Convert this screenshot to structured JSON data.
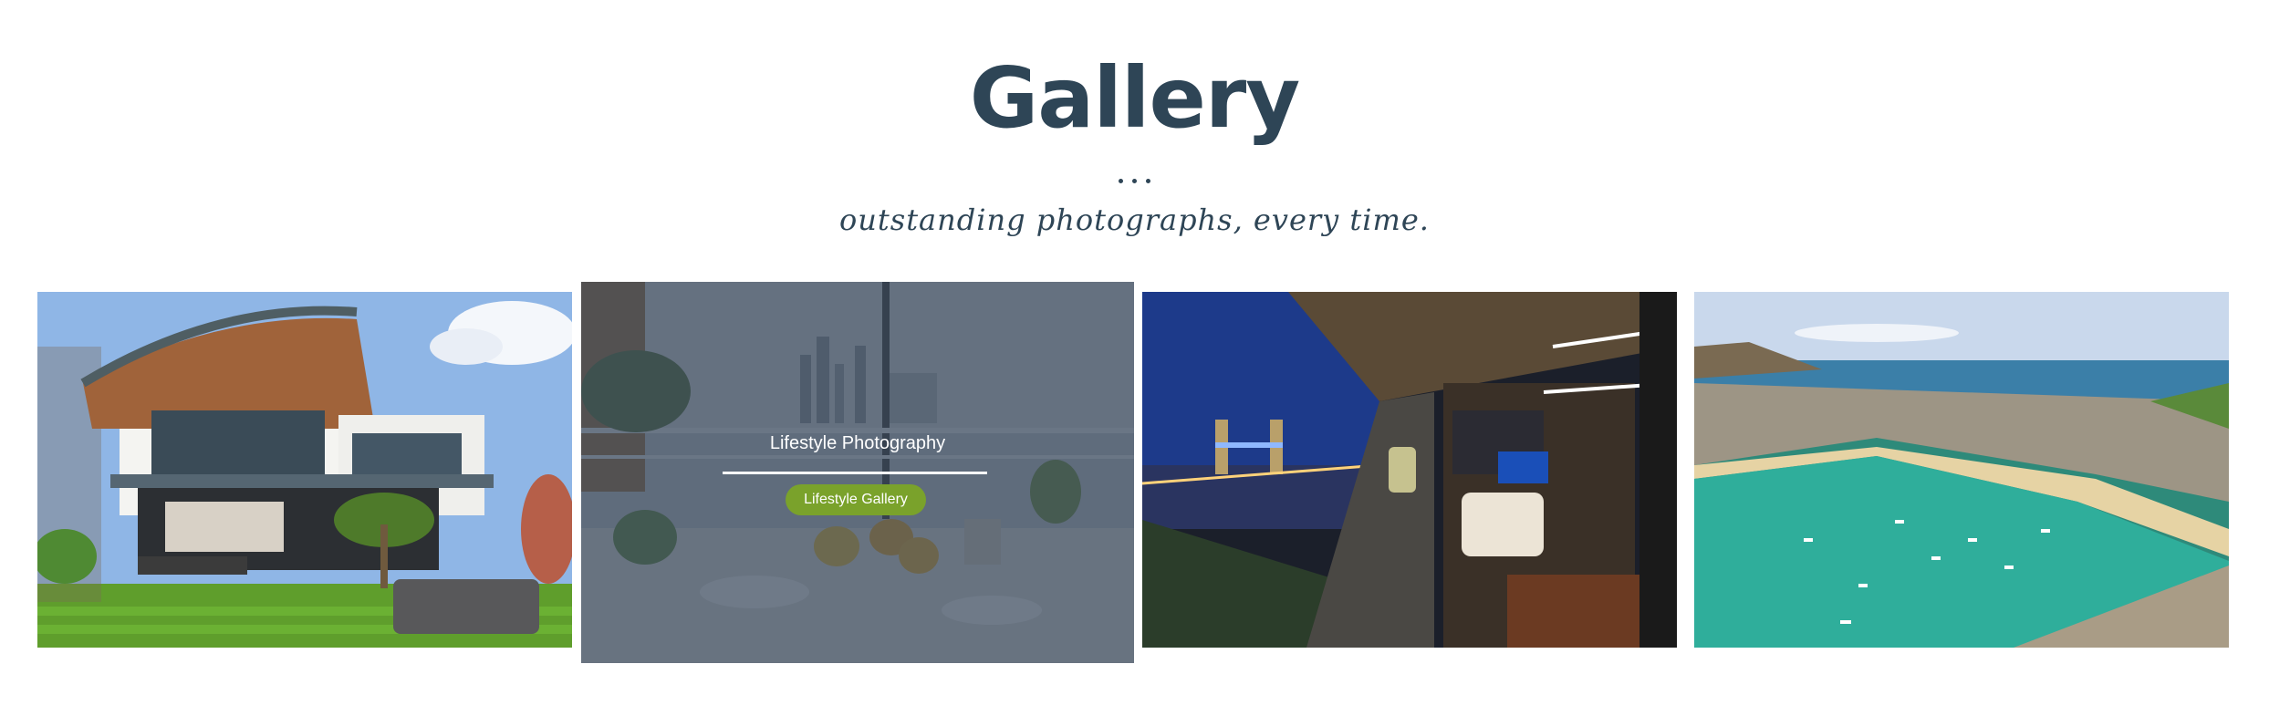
{
  "gallery": {
    "title": "Gallery",
    "subtitle": "outstanding photographs, every time.",
    "accent_color": "#7aa22b",
    "heading_color": "#2e4556",
    "items": [
      {
        "image": "modern-house-with-garden"
      },
      {
        "image": "balcony-table-city-view",
        "hover_title": "Lifestyle Photography",
        "hover_button": "Lifestyle Gallery"
      },
      {
        "image": "tower-bridge-balcony-night"
      },
      {
        "image": "aerial-harbour-town"
      }
    ]
  }
}
